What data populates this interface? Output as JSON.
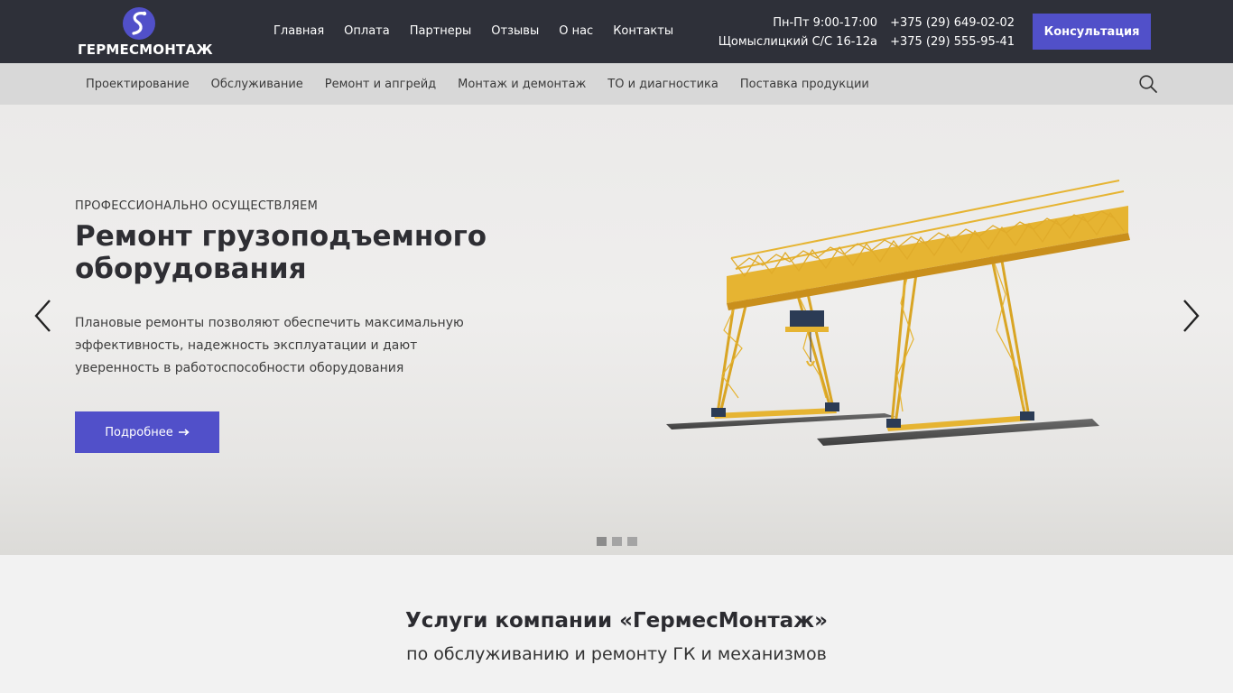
{
  "header": {
    "logo_text": "ГЕРМЕСМОНТАЖ",
    "nav": [
      "Главная",
      "Оплата",
      "Партнеры",
      "Отзывы",
      "О нас",
      "Контакты"
    ],
    "hours": "Пн-Пт 9:00-17:00",
    "address": "Щомыслицкий С/С 16-12а",
    "phone_1": "+375 (29) 649-02-02",
    "phone_2": "+375 (29) 555-95-41",
    "consult_label": "Консультация"
  },
  "services_nav": {
    "items": [
      "Проектирование",
      "Обслуживание",
      "Ремонт и апгрейд",
      "Монтаж и демонтаж",
      "ТО и диагностика",
      "Поставка продукции"
    ]
  },
  "hero": {
    "kicker": "ПРОФЕССИОНАЛЬНО ОСУЩЕСТВЛЯЕМ",
    "title": "Ремонт грузоподъемного оборудования",
    "text": "Плановые ремонты позволяют обеспечить максимальную эффективность, надежность эксплуатации и дают уверенность в работоспособности оборудования",
    "button_label": "Подробнее",
    "slide_count": 3,
    "active_slide": 1
  },
  "services": {
    "title": "Услуги компании «ГермесМонтаж»",
    "subtitle": "по обслуживанию и ремонту ГК и механизмов"
  },
  "colors": {
    "header_bg": "#2e3039",
    "accent": "#5150c9",
    "subnav_bg": "#d8d8d8",
    "crane_yellow": "#e6b432"
  }
}
